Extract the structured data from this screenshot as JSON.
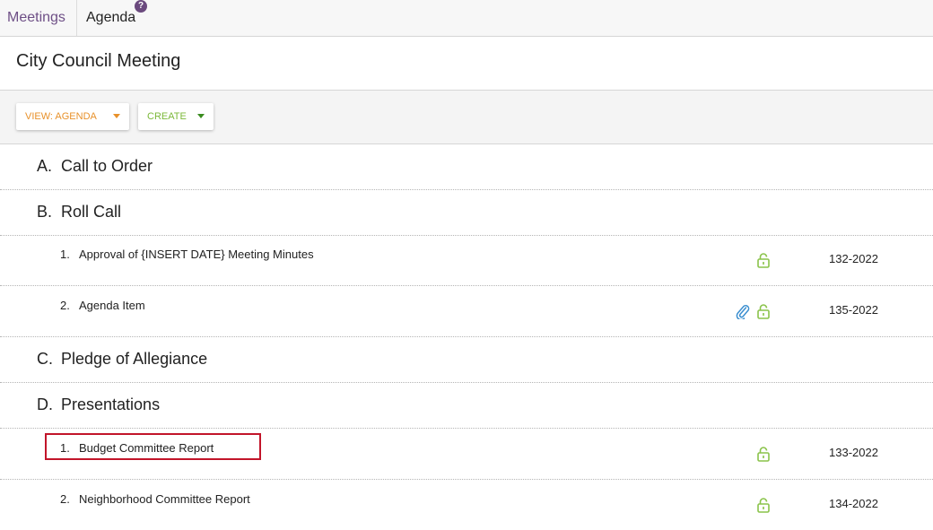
{
  "breadcrumbs": {
    "meetings": "Meetings",
    "agenda": "Agenda",
    "help": "?"
  },
  "page": {
    "title": "City Council Meeting"
  },
  "toolbar": {
    "view_label": "VIEW: AGENDA",
    "create_label": "CREATE"
  },
  "colors": {
    "accent_purple": "#6e4f86",
    "view_orange": "#e8912a",
    "create_green": "#7cb83a",
    "lock_green": "#8ac34a",
    "clip_blue": "#3b8fd0",
    "highlight_red": "#c2152a"
  },
  "sections": [
    {
      "letter": "A.",
      "title": "Call to Order"
    },
    {
      "letter": "B.",
      "title": "Roll Call",
      "items": [
        {
          "num": "1.",
          "title": "Approval of {INSERT DATE} Meeting Minutes",
          "code": "132-2022",
          "icons": [
            "lock-icon"
          ]
        },
        {
          "num": "2.",
          "title": "Agenda Item",
          "code": "135-2022",
          "icons": [
            "paperclip-icon",
            "lock-icon"
          ]
        }
      ]
    },
    {
      "letter": "C.",
      "title": "Pledge of Allegiance"
    },
    {
      "letter": "D.",
      "title": "Presentations",
      "items": [
        {
          "num": "1.",
          "title": "Budget Committee Report",
          "code": "133-2022",
          "icons": [
            "lock-icon"
          ]
        },
        {
          "num": "2.",
          "title": "Neighborhood Committee Report",
          "code": "134-2022",
          "icons": [
            "lock-icon"
          ]
        }
      ]
    }
  ]
}
